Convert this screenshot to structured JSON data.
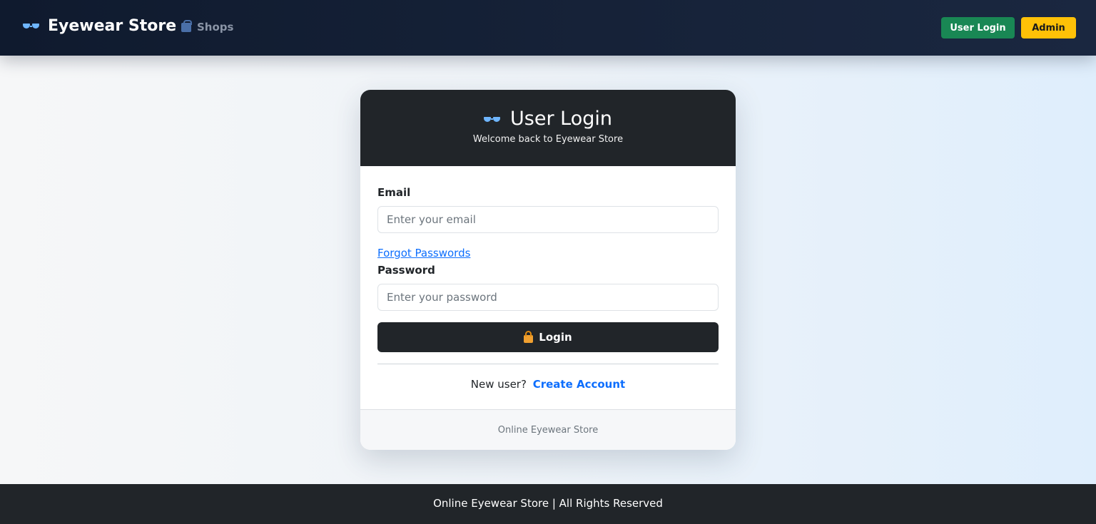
{
  "navbar": {
    "brand": "Eyewear Store",
    "brand_icon": "glasses-icon",
    "shops_label": "Shops",
    "shops_icon": "shopping-bag-icon",
    "user_login_label": "User Login",
    "admin_label": "Admin"
  },
  "login_card": {
    "title": "User Login",
    "title_icon": "glasses-icon",
    "subtitle": "Welcome back to Eyewear Store",
    "email_label": "Email",
    "email_placeholder": "Enter your email",
    "forgot_label": "Forgot Passwords",
    "password_label": "Password",
    "password_placeholder": "Enter your password",
    "login_button_label": "Login",
    "login_button_icon": "lock-icon",
    "new_user_text": "New user?",
    "create_account_label": "Create Account",
    "footer_text": "Online Eyewear Store"
  },
  "footer": {
    "text": "Online Eyewear Store | All Rights Reserved"
  },
  "colors": {
    "navbar_bg": "#0f1a2e",
    "user_login_btn": "#198754",
    "admin_btn": "#ffc107",
    "card_header": "#212529",
    "link": "#0d6efd",
    "footer_bg": "#212529"
  }
}
